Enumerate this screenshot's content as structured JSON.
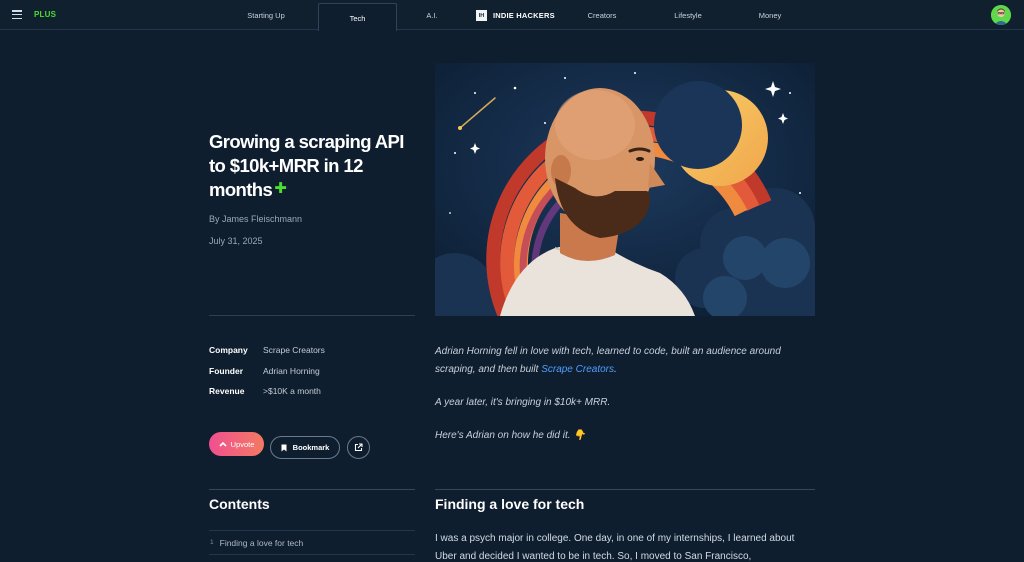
{
  "nav": {
    "plus_label": "PLUS",
    "links": [
      "Starting Up",
      "Tech",
      "A.I.",
      "Creators",
      "Lifestyle",
      "Money"
    ],
    "active_tab": "Tech",
    "logo_mark": "IH",
    "logo_text": "INDIE HACKERS",
    "menu_icon": "hamburger-icon",
    "avatar_icon": "user-avatar"
  },
  "article": {
    "title": "Growing a scraping API to $10k+MRR in 12 months",
    "title_badge": "✚",
    "byline": "By James Fleischmann",
    "date": "July 31, 2025"
  },
  "facts": [
    {
      "label": "Company",
      "value": "Scrape Creators"
    },
    {
      "label": "Founder",
      "value": "Adrian Horning"
    },
    {
      "label": "Revenue",
      "value": ">$10K a month"
    }
  ],
  "actions": {
    "upvote": "Upvote",
    "bookmark": "Bookmark",
    "share_icon": "external-link-icon"
  },
  "intro": {
    "p1_before": "Adrian Horning fell in love with tech, learned to code, built an audience around scraping, and then built ",
    "p1_link": "Scrape Creators",
    "p1_after": ".",
    "p2": "A year later, it's bringing in $10k+ MRR.",
    "p3": "Here's Adrian on how he did it.",
    "p3_emoji": "👇"
  },
  "contents": {
    "title": "Contents",
    "items": [
      {
        "num": "1",
        "label": "Finding a love for tech"
      }
    ]
  },
  "section": {
    "title": "Finding a love for tech",
    "body": "I was a psych major in college. One day, in one of my internships, I learned about Uber and decided I wanted to be in tech. So, I moved to San Francisco,"
  },
  "colors": {
    "background": "#0f1e2f",
    "accent_green": "#4ade2e",
    "link_blue": "#4f9dff",
    "upvote_gradient_start": "#f0508f",
    "upvote_gradient_end": "#f27a63"
  }
}
